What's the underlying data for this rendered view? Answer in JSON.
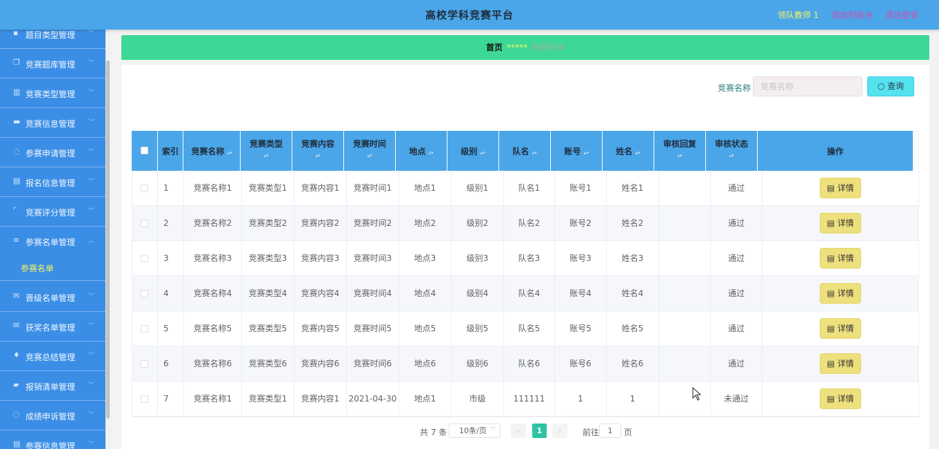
{
  "header": {
    "title": "高校学科竞赛平台",
    "user": "领队教师 1",
    "back_link": "退出到前台",
    "logout_link": "退出登录"
  },
  "sidebar": {
    "items": [
      {
        "label": "题目类型管理",
        "icon": "chat-icon"
      },
      {
        "label": "竞赛题库管理",
        "icon": "copy-icon"
      },
      {
        "label": "竞赛类型管理",
        "icon": "building-icon"
      },
      {
        "label": "竞赛信息管理",
        "icon": "monitor-icon"
      },
      {
        "label": "参赛申请管理",
        "icon": "info-icon"
      },
      {
        "label": "报名信息管理",
        "icon": "document-icon"
      },
      {
        "label": "竞赛评分管理",
        "icon": "frame-icon"
      },
      {
        "label": "参赛名单管理",
        "icon": "menu-icon"
      },
      {
        "label": "晋级名单管理",
        "icon": "mail-icon"
      },
      {
        "label": "获奖名单管理",
        "icon": "mail-icon"
      },
      {
        "label": "竞赛总结管理",
        "icon": "mic-icon"
      },
      {
        "label": "报销清单管理",
        "icon": "suitcase-icon"
      },
      {
        "label": "成绩申诉管理",
        "icon": "info-icon"
      },
      {
        "label": "参赛信息管理",
        "icon": "document-icon"
      }
    ],
    "active_sub": "参赛名单"
  },
  "breadcrumb": {
    "home": "首页",
    "separator": "*****",
    "current": "参赛名单"
  },
  "search": {
    "label": "竞赛名称",
    "placeholder": "竞赛名称",
    "button": "查询"
  },
  "table": {
    "columns": [
      "索引",
      "竞赛名称",
      "竞赛类型",
      "竞赛内容",
      "竞赛时间",
      "地点",
      "级别",
      "队名",
      "账号",
      "姓名",
      "审核回复",
      "审核状态",
      "操作"
    ],
    "rows": [
      {
        "index": "1",
        "name": "竞赛名称1",
        "type": "竞赛类型1",
        "content": "竞赛内容1",
        "time": "竞赛时间1",
        "place": "地点1",
        "level": "级别1",
        "team": "队名1",
        "account": "账号1",
        "person": "姓名1",
        "reply": "",
        "status": "通过"
      },
      {
        "index": "2",
        "name": "竞赛名称2",
        "type": "竞赛类型2",
        "content": "竞赛内容2",
        "time": "竞赛时间2",
        "place": "地点2",
        "level": "级别2",
        "team": "队名2",
        "account": "账号2",
        "person": "姓名2",
        "reply": "",
        "status": "通过"
      },
      {
        "index": "3",
        "name": "竞赛名称3",
        "type": "竞赛类型3",
        "content": "竞赛内容3",
        "time": "竞赛时间3",
        "place": "地点3",
        "level": "级别3",
        "team": "队名3",
        "account": "账号3",
        "person": "姓名3",
        "reply": "",
        "status": "通过"
      },
      {
        "index": "4",
        "name": "竞赛名称4",
        "type": "竞赛类型4",
        "content": "竞赛内容4",
        "time": "竞赛时间4",
        "place": "地点4",
        "level": "级别4",
        "team": "队名4",
        "account": "账号4",
        "person": "姓名4",
        "reply": "",
        "status": "通过"
      },
      {
        "index": "5",
        "name": "竞赛名称5",
        "type": "竞赛类型5",
        "content": "竞赛内容5",
        "time": "竞赛时间5",
        "place": "地点5",
        "level": "级别5",
        "team": "队名5",
        "account": "账号5",
        "person": "姓名5",
        "reply": "",
        "status": "通过"
      },
      {
        "index": "6",
        "name": "竞赛名称6",
        "type": "竞赛类型6",
        "content": "竞赛内容6",
        "time": "竞赛时间6",
        "place": "地点6",
        "level": "级别6",
        "team": "队名6",
        "account": "账号6",
        "person": "姓名6",
        "reply": "",
        "status": "通过"
      },
      {
        "index": "7",
        "name": "竞赛名称1",
        "type": "竞赛类型1",
        "content": "竞赛内容1",
        "time": "2021-04-30",
        "place": "地点1",
        "level": "市级",
        "team": "111111",
        "account": "1",
        "person": "1",
        "reply": "",
        "status": "未通过"
      }
    ],
    "detail_button": "详情"
  },
  "pagination": {
    "total": "共 7 条",
    "page_size": "10条/页",
    "current_page": "1",
    "goto_label": "前往",
    "goto_value": "1",
    "page_suffix": "页"
  },
  "colors": {
    "header": "#4aa6e8",
    "sidebar": "#3a8ee6",
    "breadcrumb": "#3dd895",
    "detail_button": "#eee07d",
    "search_button": "#54e2ee",
    "active_page": "#2ec3a1"
  }
}
